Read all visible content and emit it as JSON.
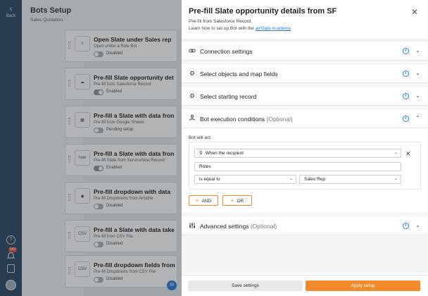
{
  "rail": {
    "back_label": "Back",
    "notification_count": "549"
  },
  "page": {
    "title": "Bots Setup",
    "subtitle": "Sales Quotation"
  },
  "bots": [
    {
      "title": "Open Slate under Sales rep",
      "subtitle": "Open under a Role Bot",
      "status": "Disabled",
      "enabled": false,
      "icon": "person-icon"
    },
    {
      "title": "Pre-fill Slate opportunity det",
      "subtitle": "Pre-fill from Salesforce Record",
      "status": "Enabled",
      "enabled": true,
      "icon": "salesforce-icon"
    },
    {
      "title": "Pre-fill a Slate with data fron",
      "subtitle": "Pre-fill from Google Sheets",
      "status": "Pending setup",
      "enabled": false,
      "icon": "google-sheets-icon"
    },
    {
      "title": "Pre-fill a Slate with data fron",
      "subtitle": "Pre-fill Slate from ServiceNow Record",
      "status": "Enabled",
      "enabled": true,
      "icon": "servicenow-icon"
    },
    {
      "title": "Pre-fill dropdown with data",
      "subtitle": "Pre-fill Dropdowns from Airtable",
      "status": "Disabled",
      "enabled": false,
      "icon": "airtable-icon"
    },
    {
      "title": "Pre-fill a Slate with data take",
      "subtitle": "Pre-fill from CSV File",
      "status": "Disabled",
      "enabled": false,
      "icon": "csv-icon"
    },
    {
      "title": "Pre-fill dropdown fields from",
      "subtitle": "Pre-fill Dropdowns from CSV File",
      "status": "Disabled",
      "enabled": false,
      "icon": "csv-icon"
    }
  ],
  "drawer": {
    "title": "Pre-fill Slate opportunity details from SF",
    "subtitle": "Pre-fill from Salesforce Record",
    "learn_text": "Learn how to set up Bot with the",
    "learn_link": "airSlate Academy",
    "sections": [
      {
        "label": "Connection settings",
        "optional": "",
        "icon": "link-icon",
        "expanded": false
      },
      {
        "label": "Select objects and map fields",
        "optional": "",
        "icon": "gear-icon",
        "expanded": false
      },
      {
        "label": "Select starting record",
        "optional": "",
        "icon": "gear-icon",
        "expanded": false
      },
      {
        "label": "Bot execution conditions",
        "optional": "(Optional)",
        "icon": "conditions-icon",
        "expanded": true
      },
      {
        "label": "Advanced settings",
        "optional": "(Optional)",
        "icon": "sliders-icon",
        "expanded": false
      }
    ],
    "conditions": {
      "bot_will_act": "Bot will act",
      "when": "When the recipient",
      "field": "Roles",
      "operator": "is equal to",
      "value": "Sales Rep",
      "and_label": "AND",
      "or_label": "OR"
    },
    "footer": {
      "save_label": "Save settings",
      "apply_label": "Apply setup"
    }
  },
  "colors": {
    "accent": "#f08a2a",
    "link": "#2f7bd6",
    "rail": "#2f4a62"
  }
}
